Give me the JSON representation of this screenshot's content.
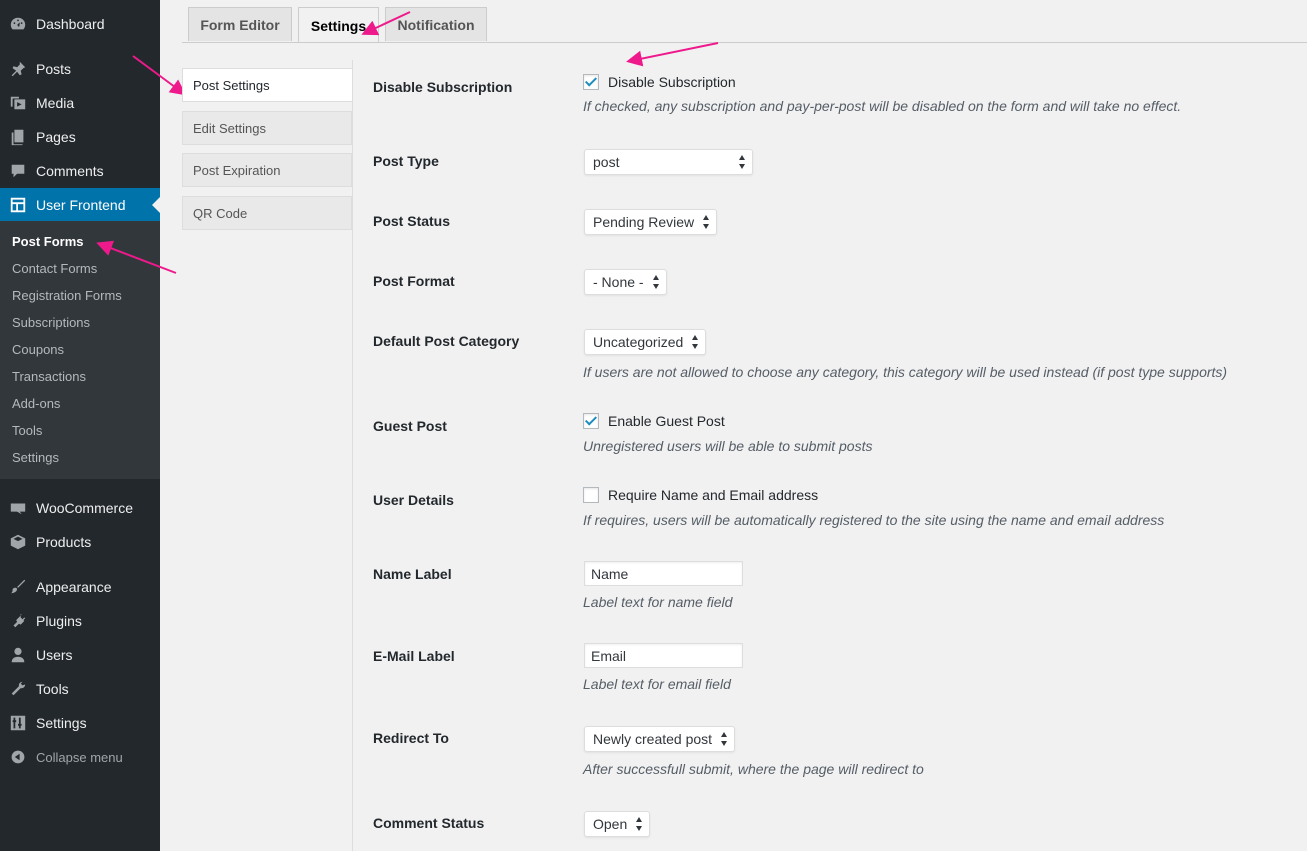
{
  "sidebar": {
    "menu": [
      {
        "label": "Dashboard",
        "icon": "dashboard-icon"
      },
      {
        "label": "Posts",
        "icon": "pin-icon"
      },
      {
        "label": "Media",
        "icon": "media-icon"
      },
      {
        "label": "Pages",
        "icon": "pages-icon"
      },
      {
        "label": "Comments",
        "icon": "comment-icon"
      },
      {
        "label": "User Frontend",
        "icon": "layout-icon"
      },
      {
        "label": "WooCommerce",
        "icon": "woo-icon"
      },
      {
        "label": "Products",
        "icon": "box-icon"
      },
      {
        "label": "Appearance",
        "icon": "brush-icon"
      },
      {
        "label": "Plugins",
        "icon": "plug-icon"
      },
      {
        "label": "Users",
        "icon": "user-icon"
      },
      {
        "label": "Tools",
        "icon": "wrench-icon"
      },
      {
        "label": "Settings",
        "icon": "sliders-icon"
      },
      {
        "label": "Collapse menu",
        "icon": "collapse-icon"
      }
    ],
    "submenu": [
      "Post Forms",
      "Contact Forms",
      "Registration Forms",
      "Subscriptions",
      "Coupons",
      "Transactions",
      "Add-ons",
      "Tools",
      "Settings"
    ]
  },
  "tabs": [
    "Form Editor",
    "Settings",
    "Notification"
  ],
  "vertical_tabs": [
    "Post Settings",
    "Edit Settings",
    "Post Expiration",
    "QR Code"
  ],
  "fields": {
    "disable_subscription": {
      "label": "Disable Subscription",
      "checkbox": "Disable Subscription",
      "checked": true,
      "desc": "If checked, any subscription and pay-per-post will be disabled on the form and will take no effect."
    },
    "post_type": {
      "label": "Post Type",
      "value": "post"
    },
    "post_status": {
      "label": "Post Status",
      "value": "Pending Review"
    },
    "post_format": {
      "label": "Post Format",
      "value": "- None -"
    },
    "default_category": {
      "label": "Default Post Category",
      "value": "Uncategorized",
      "desc": "If users are not allowed to choose any category, this category will be used instead (if post type supports)"
    },
    "guest_post": {
      "label": "Guest Post",
      "checkbox": "Enable Guest Post",
      "checked": true,
      "desc": "Unregistered users will be able to submit posts"
    },
    "user_details": {
      "label": "User Details",
      "checkbox": "Require Name and Email address",
      "checked": false,
      "desc": "If requires, users will be automatically registered to the site using the name and email address"
    },
    "name_label": {
      "label": "Name Label",
      "value": "Name",
      "desc": "Label text for name field"
    },
    "email_label": {
      "label": "E-Mail Label",
      "value": "Email",
      "desc": "Label text for email field"
    },
    "redirect_to": {
      "label": "Redirect To",
      "value": "Newly created post",
      "desc": "After successfull submit, where the page will redirect to"
    },
    "comment_status": {
      "label": "Comment Status",
      "value": "Open"
    }
  },
  "colors": {
    "sidebar_bg": "#23282d",
    "submenu_bg": "#32373c",
    "accent": "#0073aa",
    "annotation": "#ee1a8c"
  }
}
